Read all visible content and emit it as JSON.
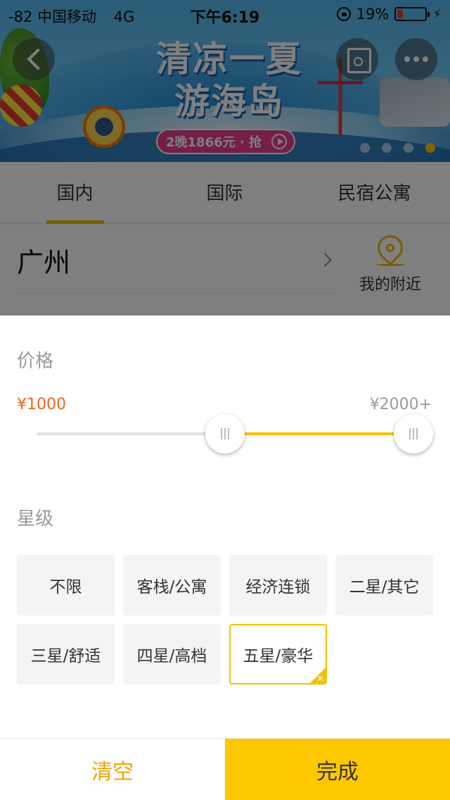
{
  "status_bar": {
    "carrier": "-82 中国移动",
    "network": "4G",
    "time": "下午6:19",
    "battery_text": "19%",
    "battery_level": 0.19
  },
  "banner": {
    "headline_line1": "清凉一夏",
    "headline_line2": "游海岛",
    "promo": "2晚1866元 · 抢",
    "active_dot": 3
  },
  "tabs": [
    {
      "label": "国内",
      "active": true
    },
    {
      "label": "国际",
      "active": false
    },
    {
      "label": "民宿公寓",
      "active": false
    }
  ],
  "location": {
    "city": "广州",
    "nearby_label": "我的附近"
  },
  "filter": {
    "price_title": "价格",
    "price_min_label": "¥1000",
    "price_max_label": "¥2000+",
    "price_range": {
      "min": 0,
      "max": 2000,
      "selected_low": 1000,
      "selected_high": 2000
    },
    "star_title": "星级",
    "star_options": [
      {
        "label": "不限",
        "selected": false
      },
      {
        "label": "客栈/公寓",
        "selected": false
      },
      {
        "label": "经济连锁",
        "selected": false
      },
      {
        "label": "二星/其它",
        "selected": false
      },
      {
        "label": "三星/舒适",
        "selected": false
      },
      {
        "label": "四星/高档",
        "selected": false
      },
      {
        "label": "五星/豪华",
        "selected": true
      }
    ]
  },
  "actions": {
    "clear_label": "清空",
    "done_label": "完成"
  },
  "colors": {
    "accent": "#fdc800",
    "price_highlight": "#f0641e",
    "clear_text": "#f5a400"
  }
}
